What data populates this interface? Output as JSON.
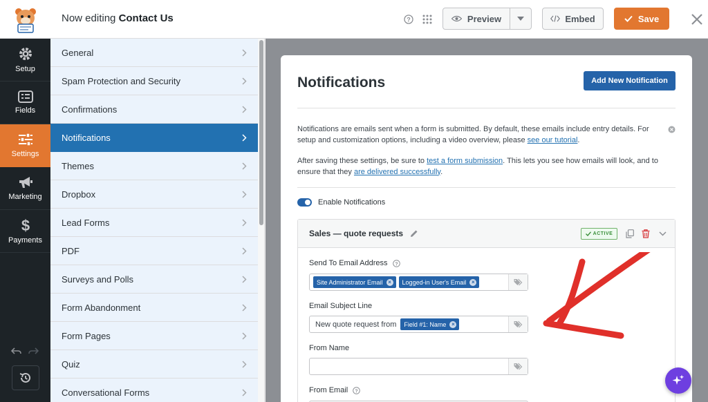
{
  "header": {
    "title_prefix": "Now editing",
    "form_name": "Contact Us",
    "preview_label": "Preview",
    "embed_label": "Embed",
    "save_label": "Save"
  },
  "rail": {
    "items": [
      {
        "label": "Setup",
        "icon": "gear-icon"
      },
      {
        "label": "Fields",
        "icon": "fields-icon"
      },
      {
        "label": "Settings",
        "icon": "sliders-icon"
      },
      {
        "label": "Marketing",
        "icon": "megaphone-icon"
      },
      {
        "label": "Payments",
        "icon": "dollar-icon"
      }
    ],
    "active_index": 2
  },
  "menu": {
    "items": [
      "General",
      "Spam Protection and Security",
      "Confirmations",
      "Notifications",
      "Themes",
      "Dropbox",
      "Lead Forms",
      "PDF",
      "Surveys and Polls",
      "Form Abandonment",
      "Form Pages",
      "Quiz",
      "Conversational Forms"
    ],
    "active_index": 3
  },
  "panel": {
    "title": "Notifications",
    "add_button": "Add New Notification",
    "intro_text": "Notifications are emails sent when a form is submitted. By default, these emails include entry details. For setup and customization options, including a video overview, please ",
    "intro_link": "see our tutorial",
    "intro_end": ".",
    "after_text_1": "After saving these settings, be sure to ",
    "after_link_1": "test a form submission",
    "after_text_2": ". This lets you see how emails will look, and to ensure that they ",
    "after_link_2": "are delivered successfully",
    "after_text_3": ".",
    "toggle_label": "Enable Notifications"
  },
  "notification": {
    "name": "Sales — quote requests",
    "status_badge": "ACTIVE",
    "send_to_label": "Send To Email Address",
    "send_to_chips": [
      "Site Administrator Email",
      "Logged-in User's Email"
    ],
    "subject_label": "Email Subject Line",
    "subject_text": "New quote request from",
    "subject_chip": "Field #1: Name",
    "from_name_label": "From Name",
    "from_email_label": "From Email"
  },
  "colors": {
    "accent_orange": "#e27730",
    "primary_blue": "#2563a9",
    "annotation_red": "#e0302a"
  }
}
